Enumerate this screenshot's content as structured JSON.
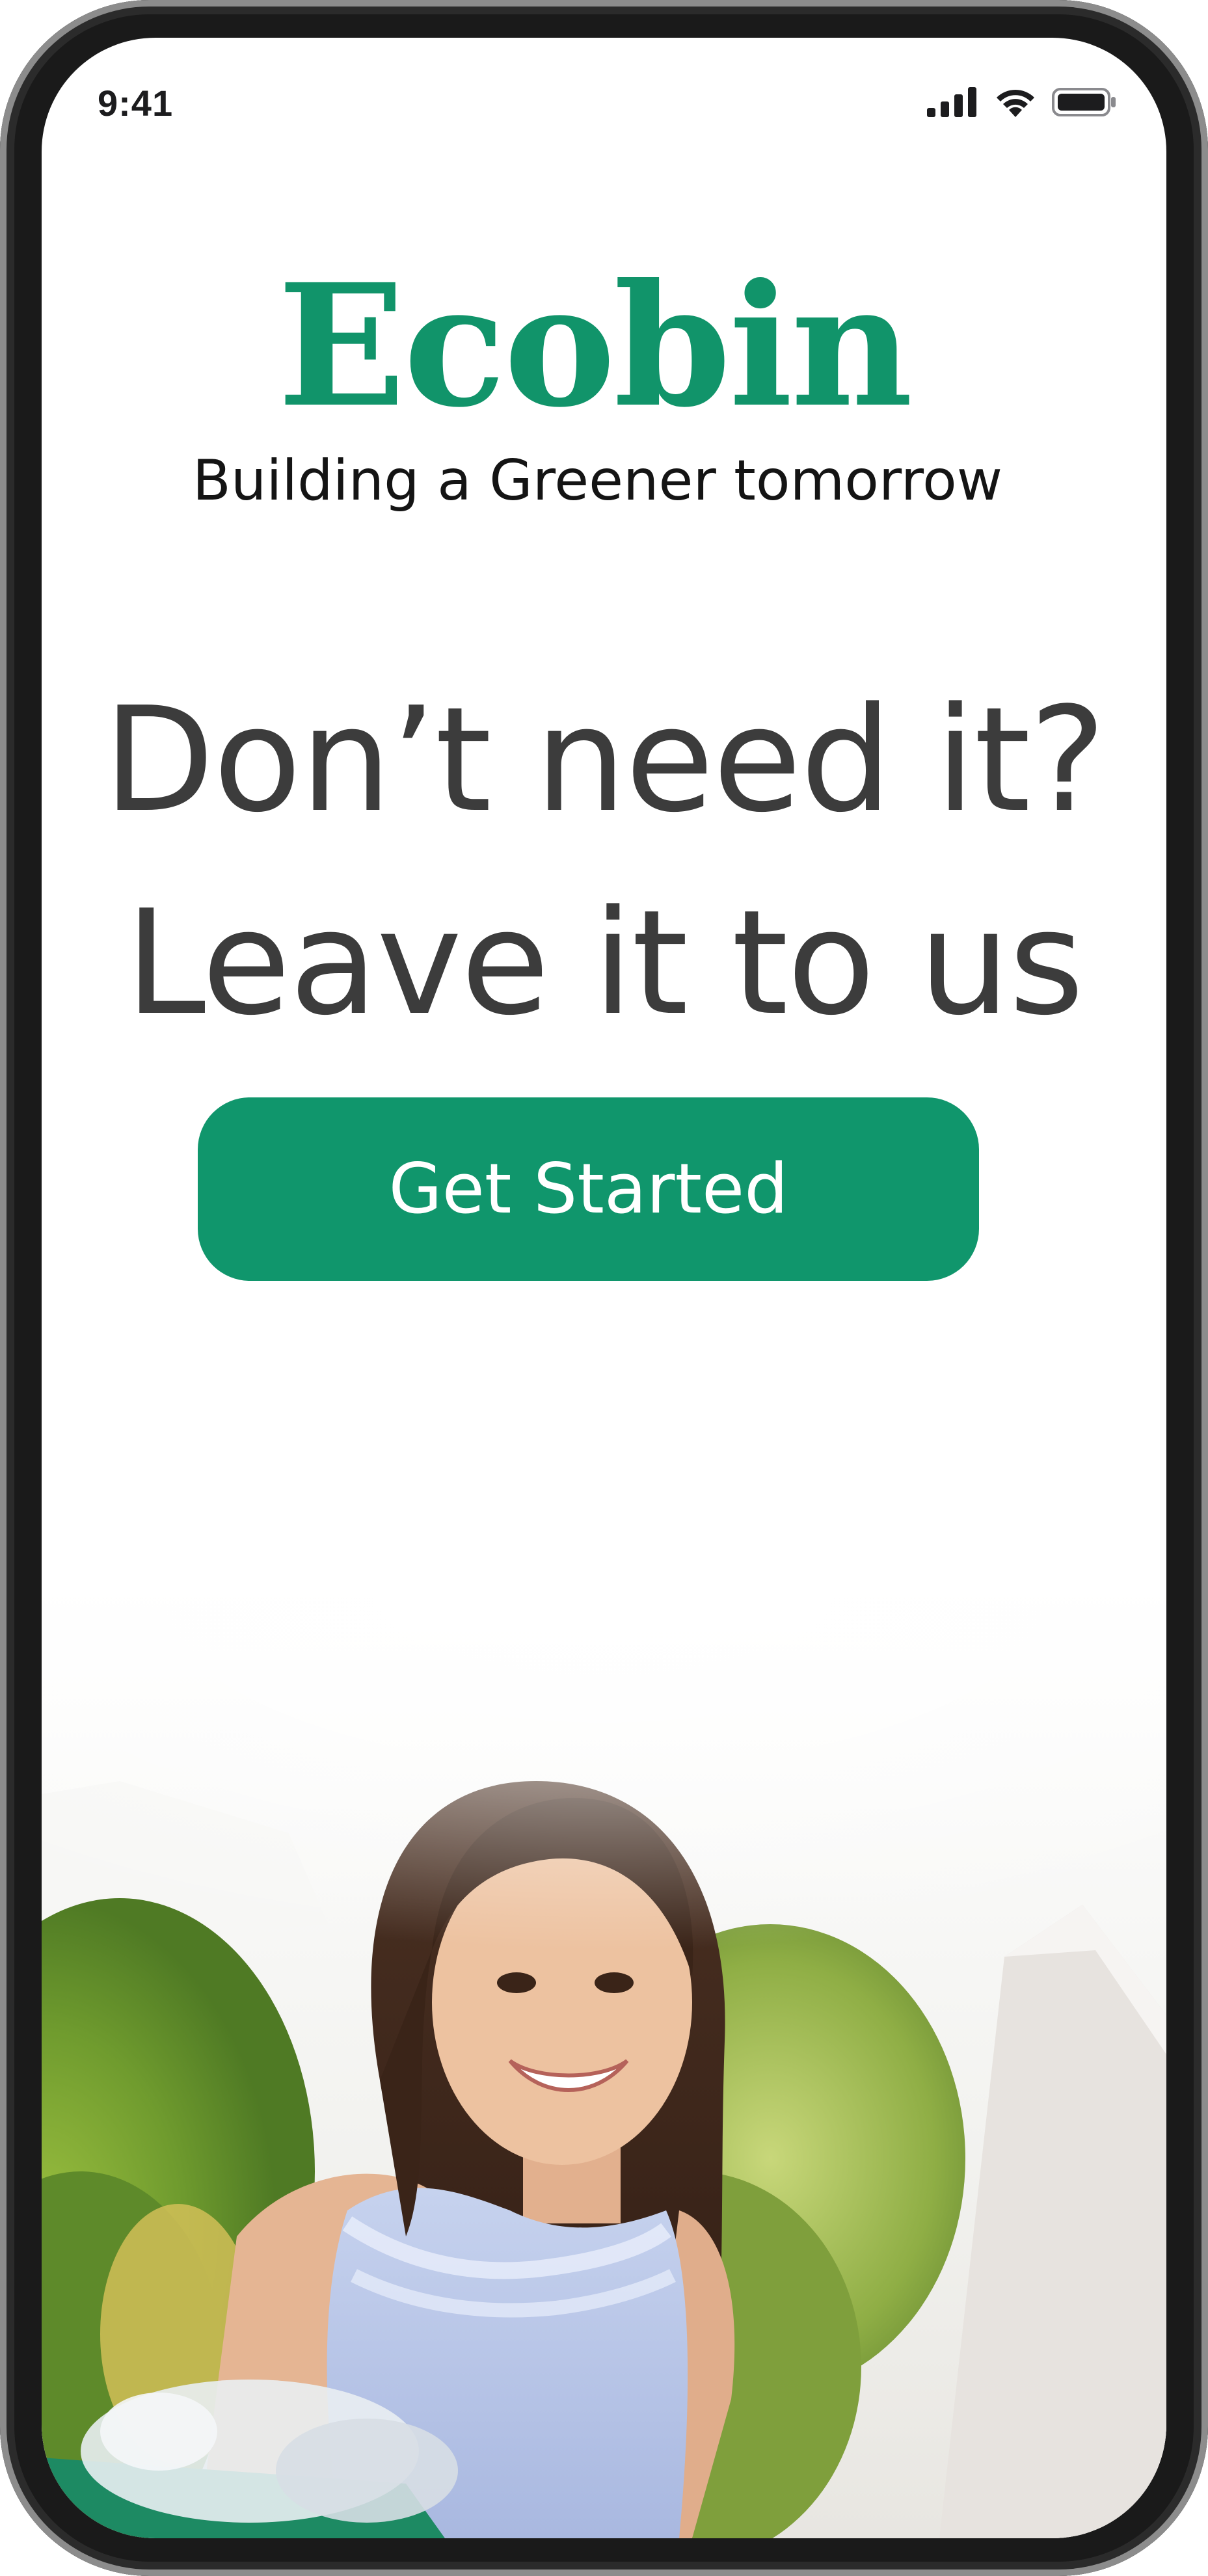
{
  "status_bar": {
    "time": "9:41",
    "icons": [
      "signal-icon",
      "wifi-icon",
      "battery-icon"
    ]
  },
  "brand": {
    "name": "Ecobin",
    "tagline": "Building a Greener tomorrow"
  },
  "hero": {
    "line1": "Don’t need it?",
    "line2": "Leave it to us"
  },
  "cta": {
    "label": "Get Started"
  },
  "photo": {
    "icon": "photo-girl-recycling"
  },
  "colors": {
    "brand_green": "#11946a",
    "button_green": "#10966c",
    "text_dark": "#3c3c3c"
  }
}
